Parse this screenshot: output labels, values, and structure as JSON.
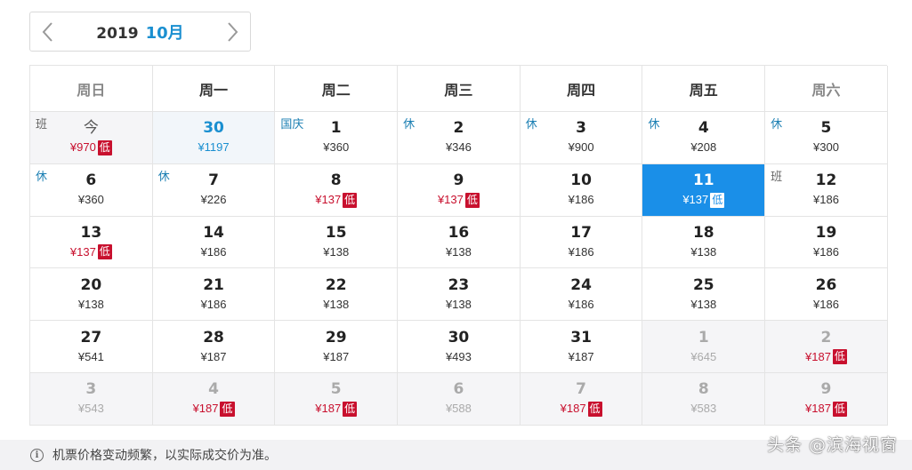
{
  "nav": {
    "year": "2019",
    "month": "10月"
  },
  "weekdays": [
    "周日",
    "周一",
    "周二",
    "周三",
    "周四",
    "周五",
    "周六"
  ],
  "days": [
    {
      "day": "今",
      "price": "¥970",
      "low": true,
      "tag": "班",
      "tagType": "work",
      "state": "past",
      "today": true
    },
    {
      "day": "30",
      "price": "¥1197",
      "low": false,
      "tag": "",
      "state": "today-plus"
    },
    {
      "day": "1",
      "price": "¥360",
      "low": false,
      "tag": "国庆",
      "tagType": "holiday"
    },
    {
      "day": "2",
      "price": "¥346",
      "low": false,
      "tag": "休",
      "tagType": "holiday"
    },
    {
      "day": "3",
      "price": "¥900",
      "low": false,
      "tag": "休",
      "tagType": "holiday"
    },
    {
      "day": "4",
      "price": "¥208",
      "low": false,
      "tag": "休",
      "tagType": "holiday"
    },
    {
      "day": "5",
      "price": "¥300",
      "low": false,
      "tag": "休",
      "tagType": "holiday"
    },
    {
      "day": "6",
      "price": "¥360",
      "low": false,
      "tag": "休",
      "tagType": "holiday"
    },
    {
      "day": "7",
      "price": "¥226",
      "low": false,
      "tag": "休",
      "tagType": "holiday"
    },
    {
      "day": "8",
      "price": "¥137",
      "low": true,
      "tag": ""
    },
    {
      "day": "9",
      "price": "¥137",
      "low": true,
      "tag": ""
    },
    {
      "day": "10",
      "price": "¥186",
      "low": false,
      "tag": ""
    },
    {
      "day": "11",
      "price": "¥137",
      "low": true,
      "tag": "",
      "state": "selected"
    },
    {
      "day": "12",
      "price": "¥186",
      "low": false,
      "tag": "班",
      "tagType": "work"
    },
    {
      "day": "13",
      "price": "¥137",
      "low": true,
      "tag": ""
    },
    {
      "day": "14",
      "price": "¥186",
      "low": false,
      "tag": ""
    },
    {
      "day": "15",
      "price": "¥138",
      "low": false,
      "tag": ""
    },
    {
      "day": "16",
      "price": "¥138",
      "low": false,
      "tag": ""
    },
    {
      "day": "17",
      "price": "¥186",
      "low": false,
      "tag": ""
    },
    {
      "day": "18",
      "price": "¥138",
      "low": false,
      "tag": ""
    },
    {
      "day": "19",
      "price": "¥186",
      "low": false,
      "tag": ""
    },
    {
      "day": "20",
      "price": "¥138",
      "low": false,
      "tag": ""
    },
    {
      "day": "21",
      "price": "¥186",
      "low": false,
      "tag": ""
    },
    {
      "day": "22",
      "price": "¥138",
      "low": false,
      "tag": ""
    },
    {
      "day": "23",
      "price": "¥138",
      "low": false,
      "tag": ""
    },
    {
      "day": "24",
      "price": "¥186",
      "low": false,
      "tag": ""
    },
    {
      "day": "25",
      "price": "¥138",
      "low": false,
      "tag": ""
    },
    {
      "day": "26",
      "price": "¥186",
      "low": false,
      "tag": ""
    },
    {
      "day": "27",
      "price": "¥541",
      "low": false,
      "tag": ""
    },
    {
      "day": "28",
      "price": "¥187",
      "low": false,
      "tag": ""
    },
    {
      "day": "29",
      "price": "¥187",
      "low": false,
      "tag": ""
    },
    {
      "day": "30",
      "price": "¥493",
      "low": false,
      "tag": ""
    },
    {
      "day": "31",
      "price": "¥187",
      "low": false,
      "tag": ""
    },
    {
      "day": "1",
      "price": "¥645",
      "low": false,
      "tag": "",
      "state": "outside"
    },
    {
      "day": "2",
      "price": "¥187",
      "low": true,
      "tag": "",
      "state": "outside"
    },
    {
      "day": "3",
      "price": "¥543",
      "low": false,
      "tag": "",
      "state": "outside"
    },
    {
      "day": "4",
      "price": "¥187",
      "low": true,
      "tag": "",
      "state": "outside"
    },
    {
      "day": "5",
      "price": "¥187",
      "low": true,
      "tag": "",
      "state": "outside"
    },
    {
      "day": "6",
      "price": "¥588",
      "low": false,
      "tag": "",
      "state": "outside"
    },
    {
      "day": "7",
      "price": "¥187",
      "low": true,
      "tag": "",
      "state": "outside"
    },
    {
      "day": "8",
      "price": "¥583",
      "low": false,
      "tag": "",
      "state": "outside"
    },
    {
      "day": "9",
      "price": "¥187",
      "low": true,
      "tag": "",
      "state": "outside"
    }
  ],
  "low_label": "低",
  "footer": {
    "notice": "机票价格变动频繁，以实际成交价为准。",
    "info_glyph": "i"
  },
  "watermark": "头条 @滨海视窗",
  "colors": {
    "accent": "#1a8fe8",
    "low": "#c8102e",
    "holiday_tag": "#1b7fb3"
  }
}
